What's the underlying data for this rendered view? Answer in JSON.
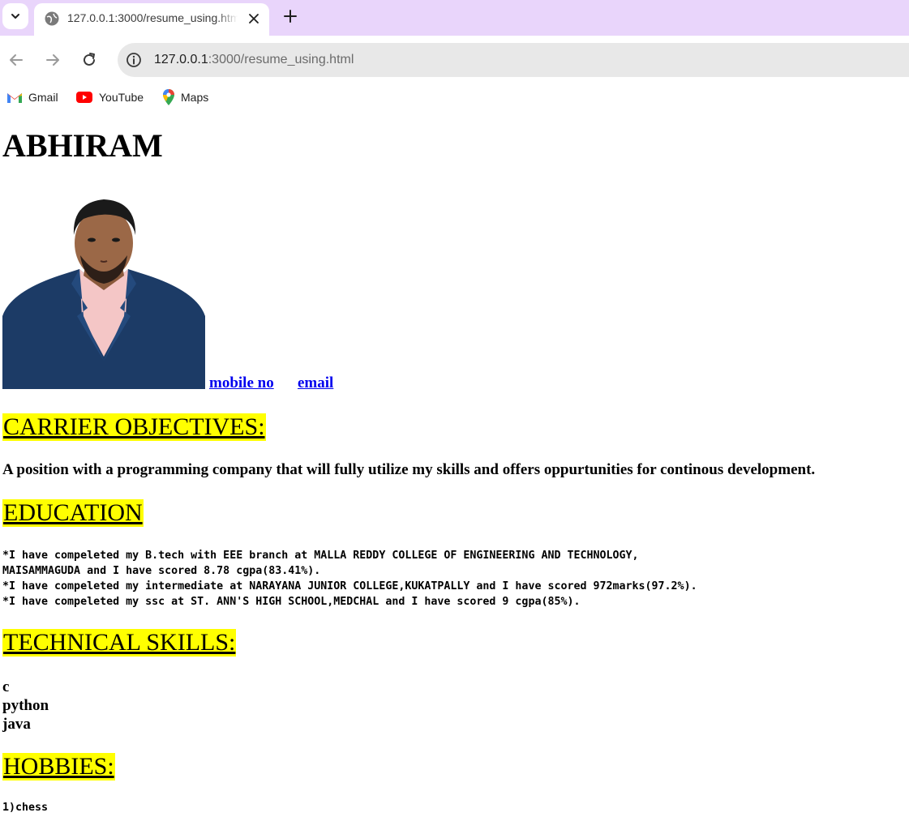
{
  "browser": {
    "tab_title": "127.0.0.1:3000/resume_using.html",
    "url_host": "127.0.0.1",
    "url_rest": ":3000/resume_using.html",
    "bookmarks": [
      {
        "label": "Gmail",
        "icon": "gmail-icon"
      },
      {
        "label": "YouTube",
        "icon": "youtube-icon"
      },
      {
        "label": "Maps",
        "icon": "maps-icon"
      }
    ],
    "colors": {
      "tabbar": "#e9d5fb",
      "omnibox": "#e8e8e8"
    }
  },
  "resume": {
    "name": "ABHIRAM",
    "photo_icon": "profile-photo",
    "links": {
      "mobile": "mobile no",
      "email": "email"
    },
    "objective_heading": "CARRIER OBJECTIVES:",
    "objective_text": "A position with a programming company that will fully utilize my skills and offers oppurtunities for continous development.",
    "education_heading": "EDUCATION",
    "education_lines": [
      "*I have compeleted my B.tech with EEE branch at MALLA REDDY COLLEGE OF ENGINEERING AND TECHNOLOGY,",
      "MAISAMMAGUDA and I have scored 8.78 cgpa(83.41%).",
      "*I have compeleted my intermediate at NARAYANA JUNIOR COLLEGE,KUKATPALLY and I have scored 972marks(97.2%).",
      "*I have compeleted my ssc at ST. ANN'S HIGH SCHOOL,MEDCHAL and I have scored 9 cgpa(85%)."
    ],
    "skills_heading": "TECHNICAL SKILLS:",
    "skills": [
      "c",
      "python",
      "java"
    ],
    "hobbies_heading": "HOBBIES:",
    "hobbies": [
      "1)chess"
    ],
    "highlight_color": "#ffff00",
    "link_color": "#0000ee"
  }
}
